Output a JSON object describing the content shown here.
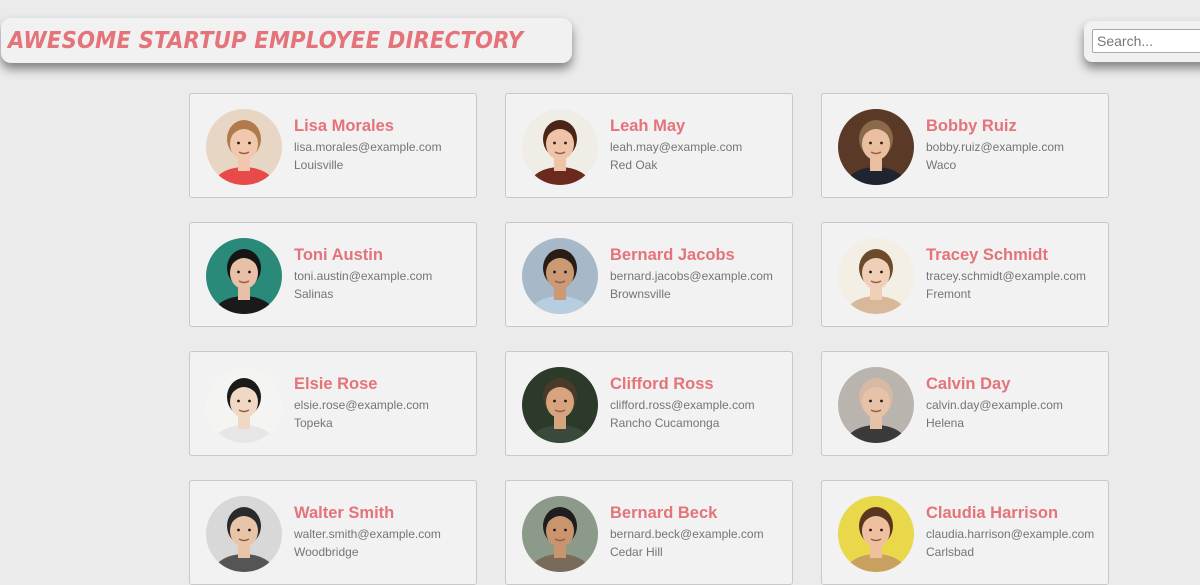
{
  "header": {
    "title": "Awesome Startup Employee Directory"
  },
  "search": {
    "placeholder": "Search..."
  },
  "colors": {
    "accent": "#e4737a",
    "background": "#ebebeb",
    "card": "#f2f2f2",
    "muted_text": "#757575"
  },
  "employees": [
    {
      "name": "Lisa Morales",
      "email": "lisa.morales@example.com",
      "city": "Louisville",
      "avatar": {
        "bg": "#e8d6c4",
        "skin": "#f1c8ad",
        "hair": "#b07a4d",
        "shirt": "#e84a4a"
      }
    },
    {
      "name": "Leah May",
      "email": "leah.may@example.com",
      "city": "Red Oak",
      "avatar": {
        "bg": "#f0ece6",
        "skin": "#eec3a8",
        "hair": "#4a2517",
        "shirt": "#6b2a1e"
      }
    },
    {
      "name": "Bobby Ruiz",
      "email": "bobby.ruiz@example.com",
      "city": "Waco",
      "avatar": {
        "bg": "#5a3a26",
        "skin": "#e9bfa0",
        "hair": "#8a6a4a",
        "shirt": "#1f2530"
      }
    },
    {
      "name": "Toni Austin",
      "email": "toni.austin@example.com",
      "city": "Salinas",
      "avatar": {
        "bg": "#2a8a7a",
        "skin": "#e8c0a8",
        "hair": "#151515",
        "shirt": "#1a1a1a"
      }
    },
    {
      "name": "Bernard Jacobs",
      "email": "bernard.jacobs@example.com",
      "city": "Brownsville",
      "avatar": {
        "bg": "#a7b8c8",
        "skin": "#c99a74",
        "hair": "#2a1d15",
        "shirt": "#b7cde0"
      }
    },
    {
      "name": "Tracey Schmidt",
      "email": "tracey.schmidt@example.com",
      "city": "Fremont",
      "avatar": {
        "bg": "#f3efe5",
        "skin": "#efcfb5",
        "hair": "#6d4a2c",
        "shirt": "#d9b89a"
      }
    },
    {
      "name": "Elsie Rose",
      "email": "elsie.rose@example.com",
      "city": "Topeka",
      "avatar": {
        "bg": "#f4f4f2",
        "skin": "#f1d8c4",
        "hair": "#1b1b1b",
        "shirt": "#e6e6e6"
      }
    },
    {
      "name": "Clifford Ross",
      "email": "clifford.ross@example.com",
      "city": "Rancho Cucamonga",
      "avatar": {
        "bg": "#2c3a2a",
        "skin": "#d8a47e",
        "hair": "#4a3a2a",
        "shirt": "#3a4a3a"
      }
    },
    {
      "name": "Calvin Day",
      "email": "calvin.day@example.com",
      "city": "Helena",
      "avatar": {
        "bg": "#b9b4ae",
        "skin": "#e6c2a9",
        "hair": "#d7b9a4",
        "shirt": "#3a3a3a"
      }
    },
    {
      "name": "Walter Smith",
      "email": "walter.smith@example.com",
      "city": "Woodbridge",
      "avatar": {
        "bg": "#d8d8d8",
        "skin": "#e8c4a8",
        "hair": "#2a2a2a",
        "shirt": "#555555"
      }
    },
    {
      "name": "Bernard Beck",
      "email": "bernard.beck@example.com",
      "city": "Cedar Hill",
      "avatar": {
        "bg": "#8c9a8a",
        "skin": "#c8956f",
        "hair": "#1e1e1e",
        "shirt": "#7a6a5a"
      }
    },
    {
      "name": "Claudia Harrison",
      "email": "claudia.harrison@example.com",
      "city": "Carlsbad",
      "avatar": {
        "bg": "#e8d84a",
        "skin": "#eec0a0",
        "hair": "#5a3520",
        "shirt": "#c8a060"
      }
    }
  ]
}
